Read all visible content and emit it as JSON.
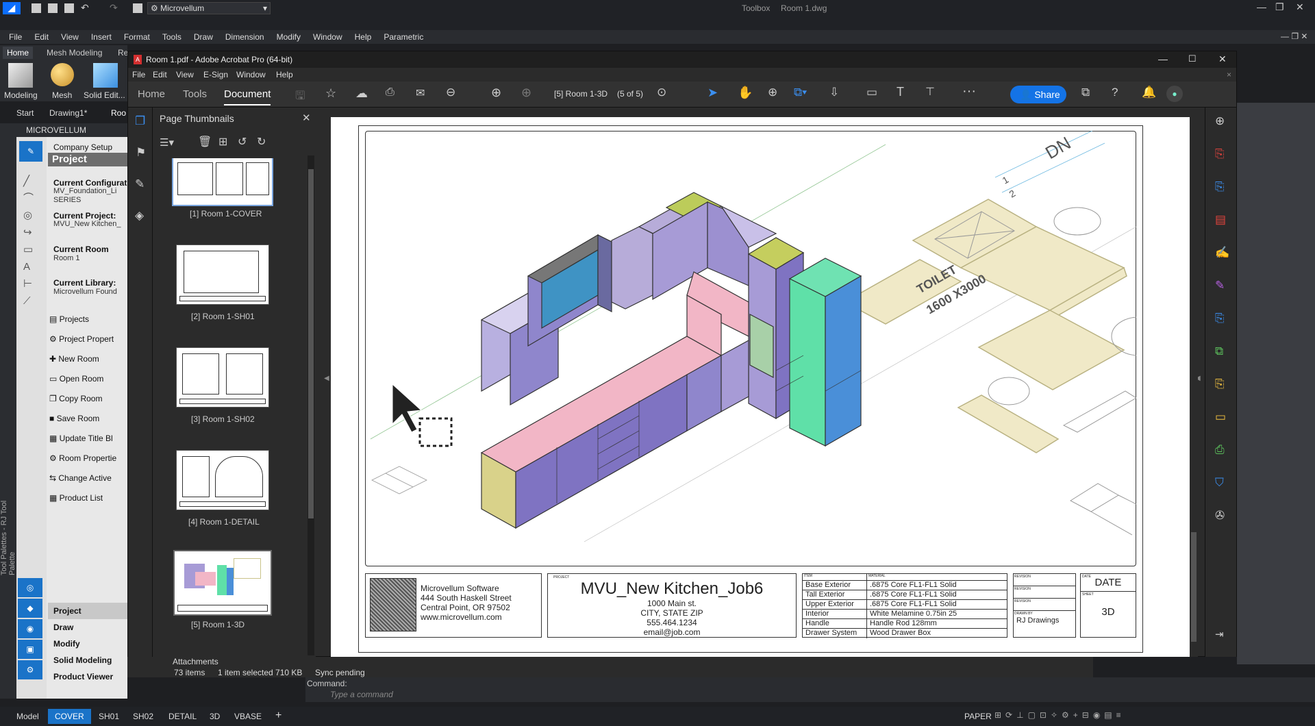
{
  "cad": {
    "workspace": "Microvellum",
    "title": "Toolbox",
    "file": "Room 1.dwg",
    "menu": [
      "File",
      "Edit",
      "View",
      "Insert",
      "Format",
      "Tools",
      "Draw",
      "Dimension",
      "Modify",
      "Window",
      "Help",
      "Parametric"
    ],
    "ribbon_tabs": [
      "Home",
      "Mesh Modeling",
      "Re"
    ],
    "ribbon_buttons": [
      "Modeling",
      "Mesh",
      "Solid Edit..."
    ],
    "doc_tabs": [
      "Start",
      "Drawing1*",
      "Roo"
    ],
    "palette_header": "MICROVELLUM",
    "palette_vertical": "Tool Palettes - RJ Tool Palette",
    "company_setup": "Company Setup",
    "project_header": "Project",
    "current_config_label": "Current Configurat",
    "current_config_value1": "MV_Foundation_Li",
    "current_config_value2": "SERIES",
    "current_project_label": "Current Project:",
    "current_project_value": "MVU_New Kitchen_",
    "current_room_label": "Current Room",
    "current_room_value": "Room 1",
    "current_library_label": "Current Library:",
    "current_library_value": "Microvellum Found",
    "actions": [
      "Projects",
      "Project Propert",
      "New Room",
      "Open Room",
      "Copy Room",
      "Save Room",
      "Update Title Bl",
      "Room Propertie",
      "Change Active",
      "Product List"
    ],
    "sections": [
      "Project",
      "Draw",
      "Modify",
      "Solid Modeling",
      "Product Viewer"
    ],
    "command_label": "Command:",
    "command_placeholder": "Type a command",
    "layout_tabs": [
      "Model",
      "COVER",
      "SH01",
      "SH02",
      "DETAIL",
      "3D",
      "VBASE",
      "+"
    ],
    "status_paper": "PAPER",
    "explorer_status": [
      "73 items",
      "1 item selected  710 KB",
      "Sync pending"
    ],
    "explorer_partial": "Attachments"
  },
  "acrobat": {
    "title": "Room 1.pdf - Adobe Acrobat Pro (64-bit)",
    "menu": [
      "File",
      "Edit",
      "View",
      "E-Sign",
      "Window",
      "Help"
    ],
    "tabs": [
      "Home",
      "Tools",
      "Document"
    ],
    "active_tab": "Document",
    "page_label": "[5] Room 1-3D",
    "page_count": "(5 of 5)",
    "share": "Share",
    "thumbs_title": "Page Thumbnails",
    "thumbnails": [
      "[1] Room 1-COVER",
      "[2] Room 1-SH01",
      "[3] Room 1-SH02",
      "[4] Room 1-DETAIL",
      "[5] Room 1-3D"
    ]
  },
  "drawing": {
    "dn": "DN",
    "dn_nums": [
      "1",
      "2"
    ],
    "toilet": "TOILET",
    "toilet_size": "1600 X3000",
    "company": [
      "Microvellum Software",
      "444 South Haskell Street",
      "Central Point, OR 97502",
      "www.microvellum.com"
    ],
    "project_tag": "PROJECT",
    "project": "MVU_New Kitchen_Job6",
    "address": [
      "1000 Main st.",
      "CITY, STATE ZIP",
      "555.464.1234",
      "email@job.com"
    ],
    "spec_headers": [
      "ITEM",
      "MATERIAL"
    ],
    "specs": [
      [
        "Base Exterior",
        ".6875 Core FL1-FL1 Solid"
      ],
      [
        "Tall Exterior",
        ".6875 Core FL1-FL1 Solid"
      ],
      [
        "Upper Exterior",
        ".6875 Core FL1-FL1 Solid"
      ],
      [
        "Interior",
        "White Melamine 0.75in 25"
      ],
      [
        "Handle",
        "Handle Rod 128mm"
      ],
      [
        "Drawer System",
        "Wood Drawer Box"
      ]
    ],
    "rev_tags": [
      "REVISION",
      "REVISION",
      "REVISION",
      "DRAWN BY"
    ],
    "drawn_by": "RJ Drawings",
    "date_tag": "DATE",
    "date": "DATE",
    "sheet_tag": "SHEET",
    "sheet": "3D"
  },
  "colors": {
    "accent": "#1473e6",
    "pink": "#f2b6c6",
    "purple": "#a79bd6",
    "blue": "#4a8fd8",
    "green": "#5fe0a8",
    "olive": "#b9c26a"
  }
}
